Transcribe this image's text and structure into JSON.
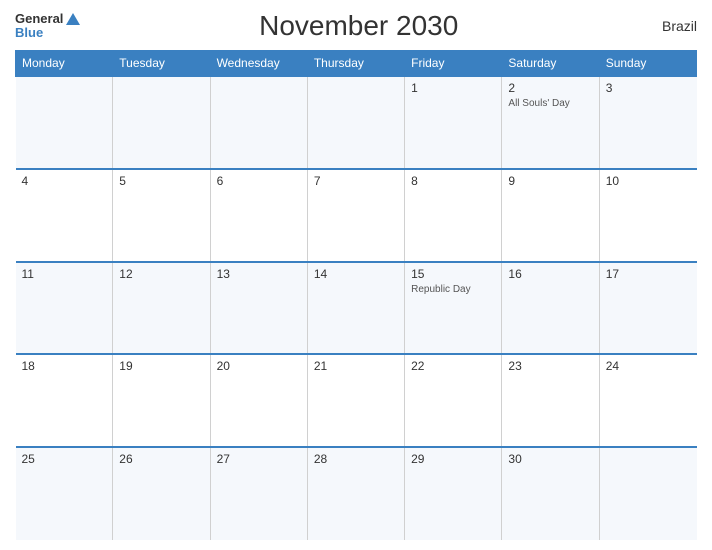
{
  "header": {
    "logo_general": "General",
    "logo_blue": "Blue",
    "title": "November 2030",
    "country": "Brazil"
  },
  "days_of_week": [
    "Monday",
    "Tuesday",
    "Wednesday",
    "Thursday",
    "Friday",
    "Saturday",
    "Sunday"
  ],
  "weeks": [
    [
      {
        "num": "",
        "holiday": ""
      },
      {
        "num": "",
        "holiday": ""
      },
      {
        "num": "",
        "holiday": ""
      },
      {
        "num": "",
        "holiday": ""
      },
      {
        "num": "1",
        "holiday": ""
      },
      {
        "num": "2",
        "holiday": "All Souls' Day"
      },
      {
        "num": "3",
        "holiday": ""
      }
    ],
    [
      {
        "num": "4",
        "holiday": ""
      },
      {
        "num": "5",
        "holiday": ""
      },
      {
        "num": "6",
        "holiday": ""
      },
      {
        "num": "7",
        "holiday": ""
      },
      {
        "num": "8",
        "holiday": ""
      },
      {
        "num": "9",
        "holiday": ""
      },
      {
        "num": "10",
        "holiday": ""
      }
    ],
    [
      {
        "num": "11",
        "holiday": ""
      },
      {
        "num": "12",
        "holiday": ""
      },
      {
        "num": "13",
        "holiday": ""
      },
      {
        "num": "14",
        "holiday": ""
      },
      {
        "num": "15",
        "holiday": "Republic Day"
      },
      {
        "num": "16",
        "holiday": ""
      },
      {
        "num": "17",
        "holiday": ""
      }
    ],
    [
      {
        "num": "18",
        "holiday": ""
      },
      {
        "num": "19",
        "holiday": ""
      },
      {
        "num": "20",
        "holiday": ""
      },
      {
        "num": "21",
        "holiday": ""
      },
      {
        "num": "22",
        "holiday": ""
      },
      {
        "num": "23",
        "holiday": ""
      },
      {
        "num": "24",
        "holiday": ""
      }
    ],
    [
      {
        "num": "25",
        "holiday": ""
      },
      {
        "num": "26",
        "holiday": ""
      },
      {
        "num": "27",
        "holiday": ""
      },
      {
        "num": "28",
        "holiday": ""
      },
      {
        "num": "29",
        "holiday": ""
      },
      {
        "num": "30",
        "holiday": ""
      },
      {
        "num": "",
        "holiday": ""
      }
    ]
  ]
}
